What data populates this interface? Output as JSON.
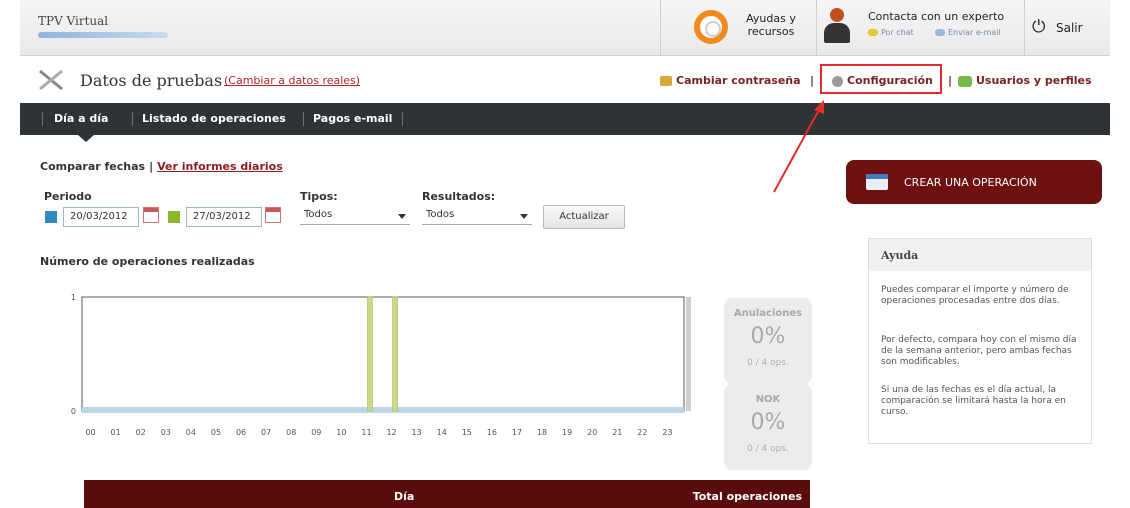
{
  "header": {
    "app_title": "TPV Virtual",
    "help_label": "Ayudas y recursos",
    "expert_title": "Contacta con un experto",
    "expert_chat": "Por chat",
    "expert_email": "Enviar e-mail",
    "logout_label": "Salir"
  },
  "section": {
    "title": "Datos de pruebas",
    "change_link": "(Cambiar a datos reales)",
    "nav": {
      "change_password": "Cambiar contraseña",
      "sep": "|",
      "config": "Configuración",
      "users": "Usuarios y perfiles"
    }
  },
  "tabs": [
    "Día a día",
    "Listado de operaciones",
    "Pagos e-mail"
  ],
  "filters": {
    "compare_label": "Comparar fechas",
    "compare_sep": "|",
    "daily_reports_link": "Ver informes diarios",
    "period_label": "Periodo",
    "date1": "20/03/2012",
    "date2": "27/03/2012",
    "types_label": "Tipos:",
    "types_value": "Todos",
    "results_label": "Resultados:",
    "results_value": "Todos",
    "update_button": "Actualizar",
    "colors": {
      "period1": "#2e8bc0",
      "period2": "#8cb829"
    }
  },
  "chart_title": "Número de operaciones realizadas",
  "chart_data": {
    "type": "bar",
    "categories": [
      "00",
      "01",
      "02",
      "03",
      "04",
      "05",
      "06",
      "07",
      "08",
      "09",
      "10",
      "11",
      "12",
      "13",
      "14",
      "15",
      "16",
      "17",
      "18",
      "19",
      "20",
      "21",
      "22",
      "23"
    ],
    "series": [
      {
        "values": [
          0,
          0,
          0,
          0,
          0,
          0,
          0,
          0,
          0,
          0,
          0,
          1,
          1,
          0,
          0,
          0,
          0,
          0,
          0,
          0,
          0,
          0,
          0,
          0
        ]
      }
    ],
    "ylim": [
      0,
      1
    ],
    "yticks": [
      "0",
      "1"
    ],
    "bar_color": "#c8d98a"
  },
  "stats": {
    "cancellations": {
      "title": "Anulaciones",
      "value": "0%",
      "ops": "0 / 4 ops."
    },
    "nok": {
      "title": "NOK",
      "value": "0%",
      "ops": "0 / 4 ops."
    }
  },
  "table": {
    "col_day": "Día",
    "col_total": "Total operaciones"
  },
  "right": {
    "create_button": "CREAR UNA OPERACIÓN",
    "help_title": "Ayuda",
    "help_p1": "Puedes comparar el importe y número de operaciones procesadas entre dos días.",
    "help_p2": "Por defecto, compara hoy con el mismo día de la semana anterior, pero ambas fechas son modificables.",
    "help_p3": "Si una de las fechas es el día actual, la comparación se limitará hasta la hora en curso."
  }
}
